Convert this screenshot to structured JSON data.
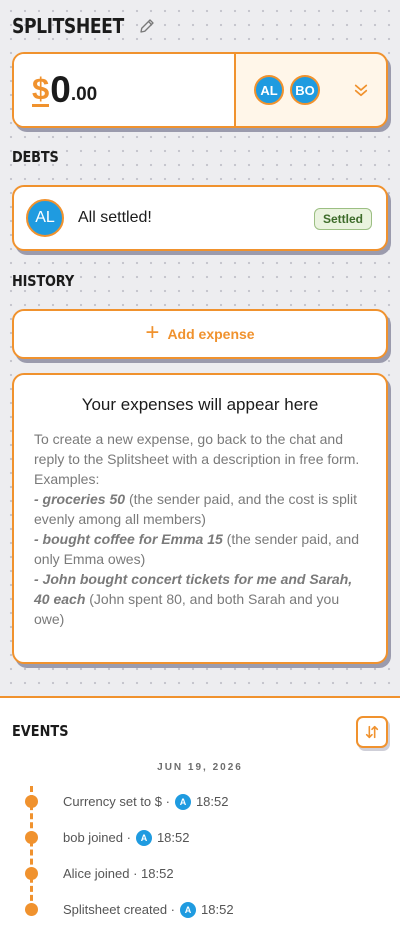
{
  "app": {
    "title": "SPLITSHEET"
  },
  "balance": {
    "currency": "$",
    "amount_int": "0",
    "amount_dec": ".00",
    "members": [
      "AL",
      "BO"
    ]
  },
  "debts": {
    "title": "DEBTS",
    "avatar": "AL",
    "message": "All settled!",
    "badge": "Settled"
  },
  "history": {
    "title": "HISTORY",
    "add_label": "Add expense",
    "empty_title": "Your expenses will appear here",
    "intro": "To create a new expense, go back to the chat and reply to the Splitsheet with a description in free form.",
    "examples_label": "Examples:",
    "examples": [
      {
        "cmd": " - groceries 50",
        "desc": " (the sender paid, and the cost is split evenly among all members)"
      },
      {
        "cmd": " - bought coffee for Emma 15",
        "desc": " (the sender paid, and only Emma owes)"
      },
      {
        "cmd": " - John bought concert tickets for me and Sarah, 40 each",
        "desc": " (John spent 80, and both Sarah and you owe)"
      }
    ]
  },
  "events": {
    "title": "EVENTS",
    "date": "JUN 19, 2026",
    "items": [
      {
        "text": "Currency set to $ ·",
        "avatar": "A",
        "time": "18:52"
      },
      {
        "text": "bob joined ·",
        "avatar": "A",
        "time": "18:52"
      },
      {
        "text": "Alice joined · 18:52",
        "avatar": "",
        "time": ""
      },
      {
        "text": "Splitsheet created ·",
        "avatar": "A",
        "time": "18:52"
      }
    ]
  },
  "colors": {
    "accent": "#f0922e",
    "avatar": "#1f9be0",
    "settled": "#3d6b2a"
  },
  "icons": {
    "edit": "pencil-icon",
    "expand": "chevron-double-down-icon",
    "add": "plus-icon",
    "sort": "sort-arrows-icon"
  }
}
